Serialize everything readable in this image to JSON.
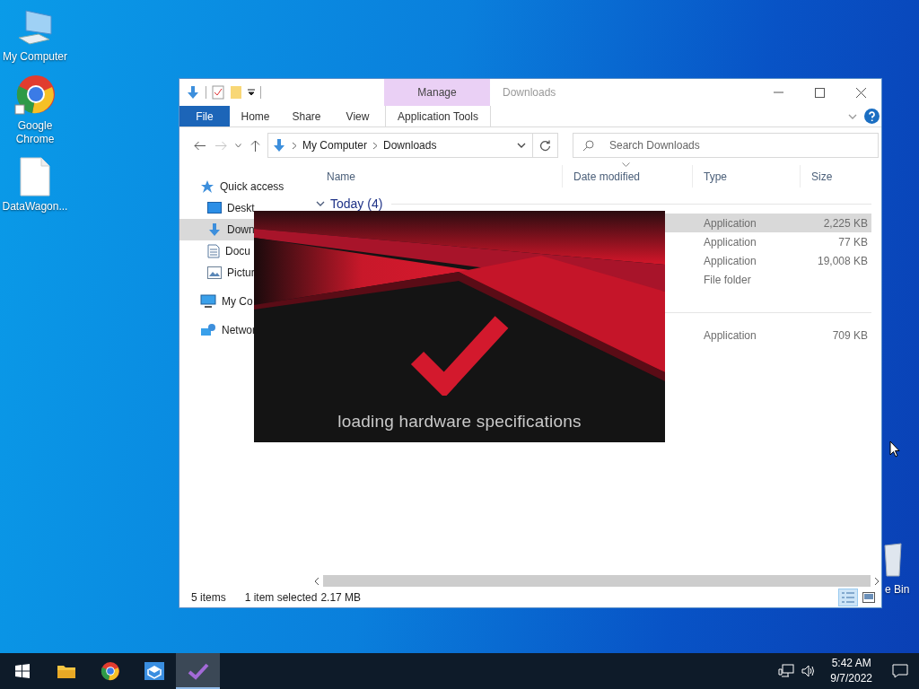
{
  "desktop_icons": [
    {
      "label": "My Computer",
      "kind": "computer"
    },
    {
      "label": "Google Chrome",
      "kind": "chrome"
    },
    {
      "label": "DataWagon...",
      "kind": "file"
    }
  ],
  "recycle_bin": {
    "label": "e Bin"
  },
  "explorer": {
    "title": "Downloads",
    "context": {
      "header": "Manage"
    },
    "ribbon_tabs": [
      {
        "label": "File",
        "kind": "file",
        "selected": false
      },
      {
        "label": "Home",
        "kind": "tab",
        "selected": false
      },
      {
        "label": "Share",
        "kind": "tab",
        "selected": false
      },
      {
        "label": "View",
        "kind": "tab",
        "selected": false
      },
      {
        "label": "Application Tools",
        "kind": "context",
        "selected": false
      }
    ],
    "address": {
      "path": [
        "My Computer",
        "Downloads"
      ]
    },
    "search": {
      "placeholder": "Search Downloads"
    },
    "nav": [
      {
        "label": "Quick access",
        "kind": "star",
        "selected": false,
        "children": [
          {
            "label": "Deskt",
            "kind": "desktop",
            "selected": false
          },
          {
            "label": "Down",
            "kind": "download",
            "selected": true
          },
          {
            "label": "Docu",
            "kind": "document",
            "selected": false
          },
          {
            "label": "Pictur",
            "kind": "pictures",
            "selected": false
          }
        ]
      },
      {
        "label": "My Co",
        "kind": "computer",
        "selected": false
      },
      {
        "label": "Networ",
        "kind": "network",
        "selected": false
      }
    ],
    "columns": [
      "Name",
      "Date modified",
      "Type",
      "Size"
    ],
    "groups": [
      {
        "header": "Today (4)",
        "rows": [
          {
            "type": "Application",
            "size": "2,225 KB",
            "selected": true
          },
          {
            "type": "Application",
            "size": "77 KB",
            "selected": false
          },
          {
            "type": "Application",
            "size": "19,008 KB",
            "selected": false
          },
          {
            "type": "File folder",
            "selected": false
          }
        ]
      },
      {
        "rows": [
          {
            "type": "Application",
            "size": "709 KB",
            "selected": false
          }
        ]
      }
    ],
    "status": {
      "count": "5 items",
      "selection": "1 item selected",
      "size": "2.17 MB"
    }
  },
  "splash": {
    "caption": "loading hardware specifications"
  },
  "taskbar": {
    "apps": [
      {
        "kind": "explorer",
        "selected": false
      },
      {
        "kind": "chrome",
        "selected": false
      },
      {
        "kind": "box",
        "selected": false
      },
      {
        "kind": "check",
        "selected": true
      }
    ],
    "time": "5:42 AM",
    "date": "9/7/2022"
  }
}
